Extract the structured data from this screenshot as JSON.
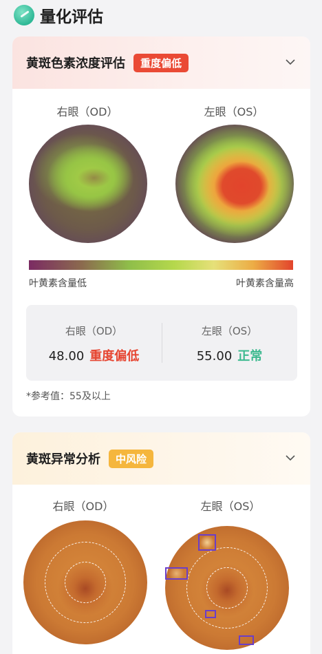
{
  "section": {
    "title": "量化评估",
    "icon": "circle-check-icon"
  },
  "pigment_card": {
    "title": "黄斑色素浓度评估",
    "badge": "重度偏低",
    "od_label": "右眼（OD）",
    "os_label": "左眼（OS）",
    "scale_low": "叶黄素含量低",
    "scale_high": "叶黄素含量高",
    "stats": {
      "od_label": "右眼（OD）",
      "od_value": "48.00",
      "od_status": "重度偏低",
      "os_label": "左眼（OS）",
      "os_value": "55.00",
      "os_status": "正常"
    },
    "reference": "*参考值：55及以上",
    "colors": {
      "badge": "#ea4a35",
      "status_low": "#e64531",
      "status_normal": "#3cb98f"
    }
  },
  "macula_card": {
    "title": "黄斑异常分析",
    "badge": "中风险",
    "od_label": "右眼（OD）",
    "os_label": "左眼（OS）",
    "colors": {
      "badge": "#f5b63d",
      "marker": "#6a3ec9"
    }
  }
}
